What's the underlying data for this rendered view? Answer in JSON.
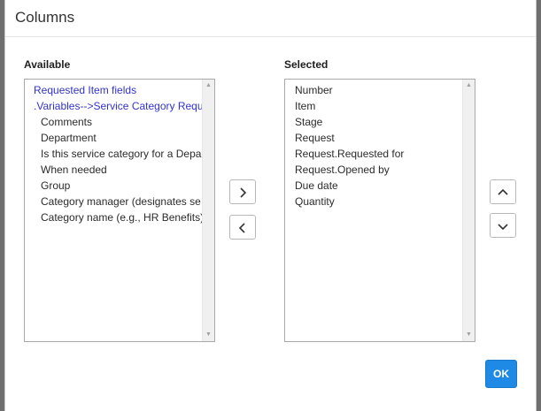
{
  "dialog": {
    "title": "Columns",
    "ok_label": "OK"
  },
  "available": {
    "label": "Available",
    "items": [
      {
        "text": "Requested Item fields",
        "group": true
      },
      {
        "text": ".Variables-->Service Category Requ",
        "group": true
      },
      {
        "text": "Comments",
        "group": false
      },
      {
        "text": "Department",
        "group": false
      },
      {
        "text": "Is this service category for a Depa",
        "group": false
      },
      {
        "text": "When needed",
        "group": false
      },
      {
        "text": "Group",
        "group": false
      },
      {
        "text": "Category manager (designates se",
        "group": false
      },
      {
        "text": "Category name (e.g., HR Benefits)",
        "group": false
      }
    ]
  },
  "selected": {
    "label": "Selected",
    "items": [
      "Number",
      "Item",
      "Stage",
      "Request",
      "Request.Requested for",
      "Request.Opened by",
      "Due date",
      "Quantity"
    ]
  },
  "icons": {
    "add": "chevron-right-icon",
    "remove": "chevron-left-icon",
    "move_up": "chevron-up-icon",
    "move_down": "chevron-down-icon",
    "scroll_up": "triangle-up-icon",
    "scroll_down": "triangle-down-icon"
  },
  "colors": {
    "primary": "#1f8ae6",
    "group_text": "#3333cc"
  }
}
